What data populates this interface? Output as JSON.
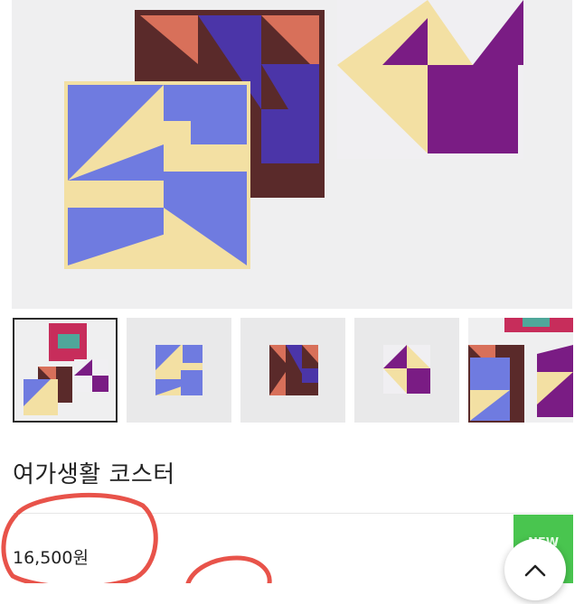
{
  "product": {
    "title": "여가생활 코스터",
    "price": "16,500원",
    "badge": "NEW"
  },
  "gallery": {
    "selected_index": 0,
    "thumbnails": [
      {
        "name": "set-overview"
      },
      {
        "name": "blue-coaster"
      },
      {
        "name": "brown-coaster"
      },
      {
        "name": "purple-coaster"
      },
      {
        "name": "scattered-coasters"
      }
    ]
  },
  "icons": {
    "scroll_top": "chevron-up-icon"
  },
  "colors": {
    "annotation": "#e8534a",
    "badge": "#49c54f",
    "blue": "#6f7be0",
    "cream": "#f3e0a3",
    "purple": "#7a1c84",
    "brown": "#5a2a2a",
    "orange": "#d8705a"
  }
}
